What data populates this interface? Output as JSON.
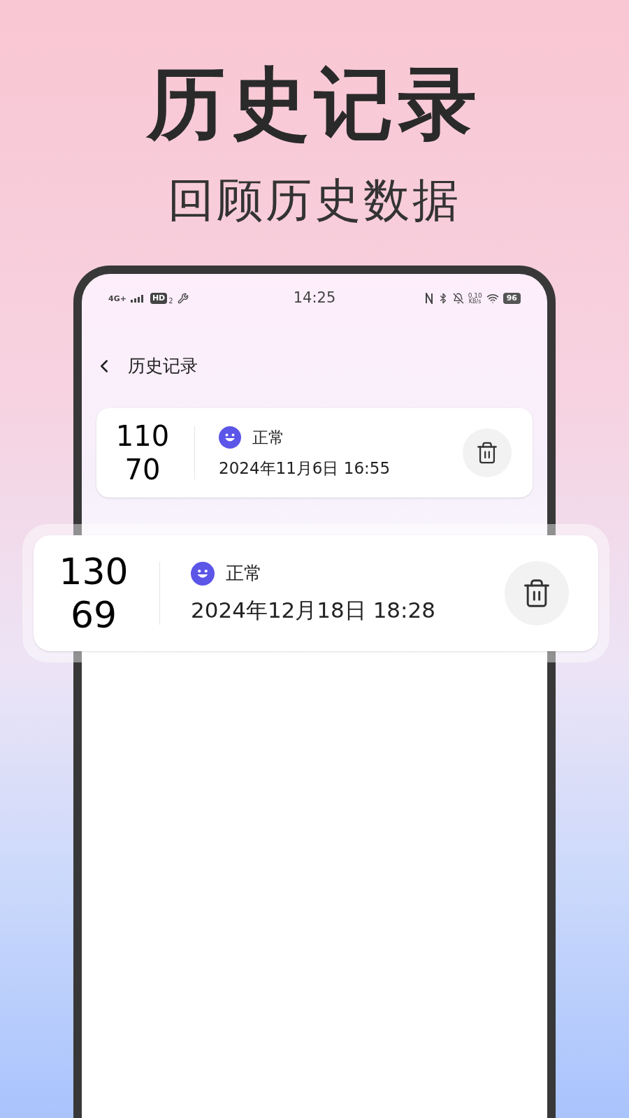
{
  "header": {
    "title": "历史记录",
    "subtitle": "回顾历史数据"
  },
  "status_bar": {
    "network": "4G+",
    "hd": "HD",
    "hd_sub": "2",
    "time": "14:25",
    "speed": "0.10",
    "speed_unit": "KB/s",
    "battery": "96"
  },
  "nav": {
    "title": "历史记录"
  },
  "records": [
    {
      "systolic": "110",
      "diastolic": "70",
      "status": "正常",
      "time": "2024年11月6日 16:55",
      "highlighted": false
    },
    {
      "systolic": "130",
      "diastolic": "69",
      "status": "正常",
      "time": "2024年12月18日 18:28",
      "highlighted": true
    }
  ]
}
